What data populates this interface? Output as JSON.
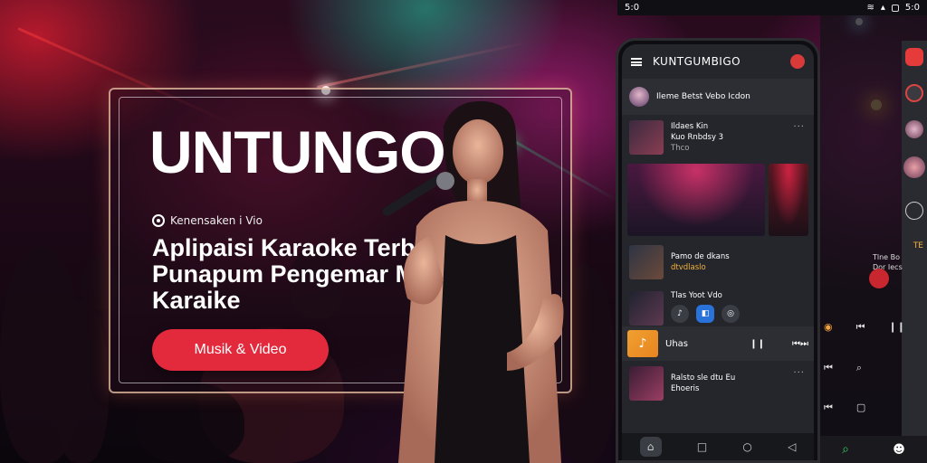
{
  "status_bar": {
    "time": "5:0",
    "right_label": "5:0"
  },
  "hero": {
    "brand": "UNTUNGO",
    "tagline": "Kenensaken i Vio",
    "headline_lines": [
      "Aplipaisi Karaoke Terbaak",
      "Punapum Pengemar Musik",
      "Karaike"
    ],
    "cta_label": "Musik & Video"
  },
  "phone": {
    "app_title": "KUNTGUMBIGO",
    "profile_text": "Ileme Betst Vebo Icdon",
    "feed": [
      {
        "line1": "Ildaes Kin",
        "line2": "Kuo Rnbdsy 3",
        "line3": "Thco"
      },
      {
        "line1": "Pamo de dkans",
        "line2": "dtvdlaslo"
      },
      {
        "line1": "Tlas Yoot Vdo"
      },
      {
        "line1": "Uhas"
      },
      {
        "line1": "Ralsto sle dtu Eu",
        "line2": "Ehoeris"
      }
    ]
  },
  "side": {
    "label_line1": "Tlne Bo",
    "label_line2": "Dor Iecs",
    "badge": "TE"
  },
  "colors": {
    "accent": "#e22a3c",
    "phone_bg": "#24262b",
    "frame": "#f0c8aa"
  }
}
